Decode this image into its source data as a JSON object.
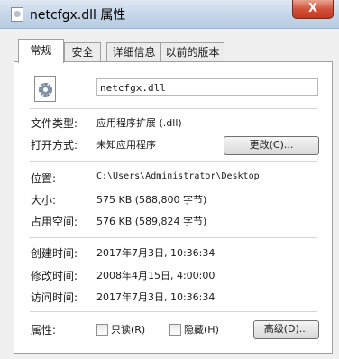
{
  "window": {
    "title": "netcfgx.dll 属性",
    "close_symbol": "X"
  },
  "tabs": [
    {
      "label": "常规",
      "active": true
    },
    {
      "label": "安全",
      "active": false
    },
    {
      "label": "详细信息",
      "active": false
    },
    {
      "label": "以前的版本",
      "active": false
    }
  ],
  "file": {
    "name": "netcfgx.dll",
    "icon": "dll-gear-file-icon"
  },
  "details": {
    "type_label": "文件类型:",
    "type_value": "应用程序扩展 (.dll)",
    "opens_label": "打开方式:",
    "opens_value": "未知应用程序",
    "change_button": "更改(C)...",
    "location_label": "位置:",
    "location_value": "C:\\Users\\Administrator\\Desktop",
    "size_label": "大小:",
    "size_value": "575 KB (588,800 字节)",
    "disk_label": "占用空间:",
    "disk_value": "576 KB (589,824 字节)",
    "created_label": "创建时间:",
    "created_value": "2017年7月3日, 10:36:34",
    "modified_label": "修改时间:",
    "modified_value": "2008年4月15日, 4:00:00",
    "accessed_label": "访问时间:",
    "accessed_value": "2017年7月3日, 10:36:34",
    "attrs_label": "属性:",
    "readonly_label": "只读(R)",
    "hidden_label": "隐藏(H)",
    "advanced_button": "高级(D)..."
  },
  "colors": {
    "close_button": "#c13a22",
    "titlebar": "#c9d8ea"
  }
}
